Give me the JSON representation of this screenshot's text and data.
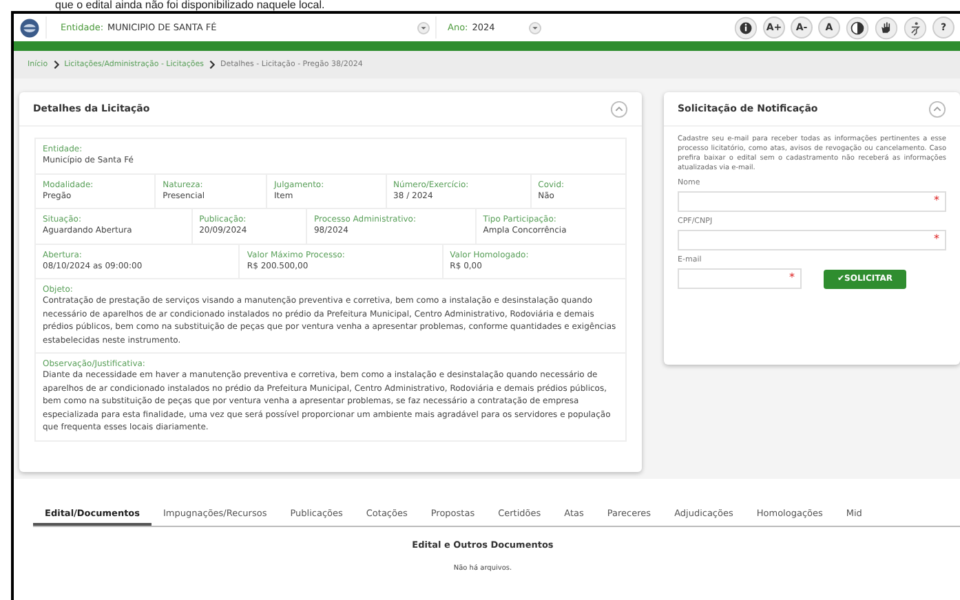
{
  "caption": "que o edital ainda não foi disponibilizado naquele local.",
  "header": {
    "entity_label": "Entidade:",
    "entity_value": "MUNICIPIO DE SANTA FÉ",
    "year_label": "Ano:",
    "year_value": "2024",
    "tools": [
      {
        "kind": "info"
      },
      {
        "kind": "text",
        "label": "A+"
      },
      {
        "kind": "text",
        "label": "A-"
      },
      {
        "kind": "text",
        "label": "A"
      },
      {
        "kind": "contrast"
      },
      {
        "kind": "hand"
      },
      {
        "kind": "access"
      },
      {
        "kind": "text",
        "label": "?"
      }
    ]
  },
  "breadcrumb": [
    "Início",
    "Licitações/Administração - Licitações",
    "Detalhes - Licitação - Pregão 38/2024"
  ],
  "details": {
    "title": "Detalhes da Licitação",
    "sections": [
      {
        "fields": [
          {
            "label": "Entidade:",
            "value": "Município de Santa Fé"
          }
        ]
      },
      {
        "fields": [
          {
            "label": "Modalidade:",
            "value": "Pregão"
          },
          {
            "label": "Natureza:",
            "value": "Presencial"
          },
          {
            "label": "Julgamento:",
            "value": "Item"
          },
          {
            "label": "Número/Exercício:",
            "value": "38 / 2024"
          },
          {
            "label": "Covid:",
            "value": "Não"
          }
        ]
      },
      {
        "fields": [
          {
            "label": "Situação:",
            "value": "Aguardando Abertura"
          },
          {
            "label": "Publicação:",
            "value": "20/09/2024"
          },
          {
            "label": "Processo Administrativo:",
            "value": "98/2024"
          },
          {
            "label": "Tipo Participação:",
            "value": "Ampla Concorrência"
          }
        ]
      },
      {
        "fields": [
          {
            "label": "Abertura:",
            "value": "08/10/2024 as 09:00:00"
          },
          {
            "label": "Valor Máximo Processo:",
            "value": "R$ 200.500,00"
          },
          {
            "label": "Valor Homologado:",
            "value": "R$ 0,00"
          }
        ]
      },
      {
        "fields": [
          {
            "label": "Objeto:",
            "value": "Contratação de prestação de serviços visando a manutenção preventiva e corretiva, bem como a instalação e desinstalação quando necessário de aparelhos de ar condicionado instalados no prédio da Prefeitura Municipal, Centro Administrativo, Rodoviária e demais prédios públicos, bem como na substituição de peças que por ventura venha a apresentar problemas, conforme quantidades e exigências estabelecidas neste instrumento."
          }
        ]
      },
      {
        "fields": [
          {
            "label": "Observação/Justificativa:",
            "value": "Diante da necessidade em haver a manutenção preventiva e corretiva, bem como a instalação e desinstalação quando necessário de aparelhos de ar condicionado instalados no prédio da Prefeitura Municipal, Centro Administrativo, Rodoviária e demais prédios públicos, bem como na substituição de peças que por ventura venha a apresentar problemas, se faz necessário a contratação de empresa especializada para esta finalidade, uma vez que será possível proporcionar um ambiente mais agradável para os servidores e população que frequenta esses locais diariamente."
          }
        ]
      }
    ]
  },
  "notification": {
    "title": "Solicitação de Notificação",
    "text": "Cadastre seu e-mail para receber todas as informações pertinentes a esse processo licitatório, como atas, avisos de revogação ou cancelamento. Caso prefira baixar o edital sem o cadastramento não receberá as informações atualizadas via e-mail.",
    "fields": [
      {
        "label": "Nome",
        "required_mark": "*"
      },
      {
        "label": "CPF/CNPJ",
        "required_mark": "*"
      },
      {
        "label": "E-mail",
        "required_mark": "*"
      }
    ],
    "button": "✔SOLICITAR"
  },
  "tabs": [
    {
      "label": "Edital/Documentos",
      "selected": true
    },
    {
      "label": "Impugnações/Recursos",
      "selected": false
    },
    {
      "label": "Publicações",
      "selected": false
    },
    {
      "label": "Cotações",
      "selected": false
    },
    {
      "label": "Propostas",
      "selected": false
    },
    {
      "label": "Certidões",
      "selected": false
    },
    {
      "label": "Atas",
      "selected": false
    },
    {
      "label": "Pareceres",
      "selected": false
    },
    {
      "label": "Adjudicações",
      "selected": false
    },
    {
      "label": "Homologações",
      "selected": false
    },
    {
      "label": "Mid",
      "selected": false
    }
  ],
  "documents": {
    "title": "Edital e Outros Documentos",
    "empty": "Não há arquivos."
  }
}
